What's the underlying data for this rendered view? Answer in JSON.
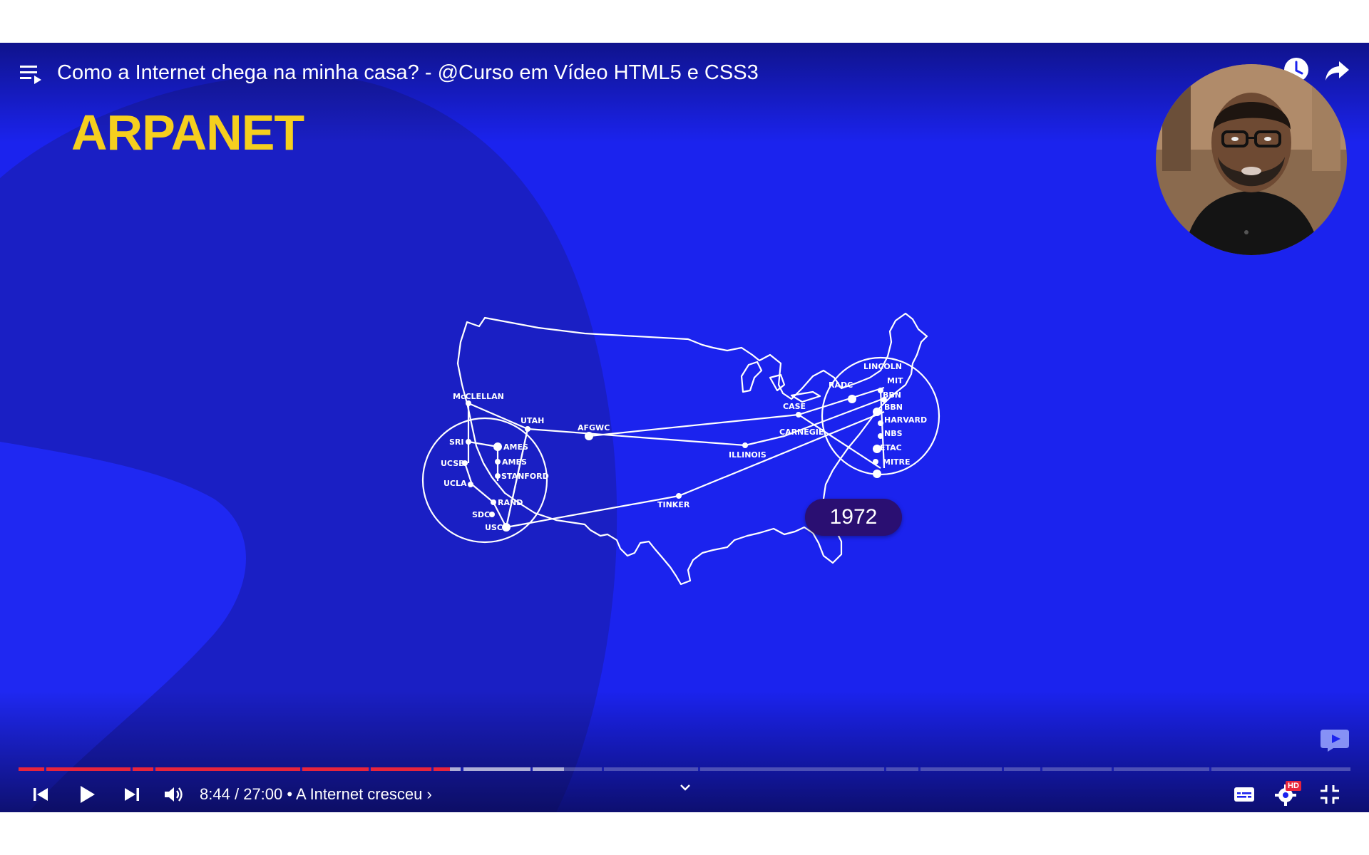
{
  "player": {
    "title": "Como a Internet chega na minha casa? - @Curso em Vídeo HTML5 e CSS3",
    "current_time": "8:44",
    "time_separator": "/",
    "duration": "27:00",
    "chapter_separator": "•",
    "chapter": "A Internet cresceu",
    "chapter_arrow": "›",
    "progress_fraction": 0.324,
    "buffered_fraction": 0.41,
    "hd_badge": "HD"
  },
  "slide": {
    "title": "ARPANET",
    "year": "1972",
    "map_labels": {
      "mcclellan": "McCLELLAN",
      "utah": "UTAH",
      "sri": "SRI",
      "ames1": "AMES",
      "ames2": "AMES",
      "ucsb": "UCSB",
      "stanford": "STANFORD",
      "ucla": "UCLA",
      "rand": "RAND",
      "sdc": "SDC",
      "usc": "USC",
      "afgwc": "AFGWC",
      "illinois": "ILLINOIS",
      "tinker": "TINKER",
      "case": "CASE",
      "carnegie": "CARNEGIE",
      "lincoln": "LINCOLN",
      "radc": "RADC",
      "mit": "MIT",
      "bbn1": "BBN",
      "bbn2": "BBN",
      "harvard": "HARVARD",
      "nbs": "NBS",
      "etac": "ETAC",
      "mitre": "MITRE"
    }
  },
  "colors": {
    "background": "#1b23ee",
    "title_yellow": "#f5cf1e",
    "progress_played": "#e8243c",
    "year_badge": "#2a0f72"
  },
  "icons": {
    "playlist": "playlist-icon",
    "watch_later": "clock-icon",
    "share": "share-icon",
    "prev": "previous-icon",
    "play": "play-icon",
    "next": "next-icon",
    "volume": "volume-icon",
    "subtitles": "subtitles-icon",
    "settings": "settings-gear-icon",
    "exit_fullscreen": "exit-fullscreen-icon"
  }
}
